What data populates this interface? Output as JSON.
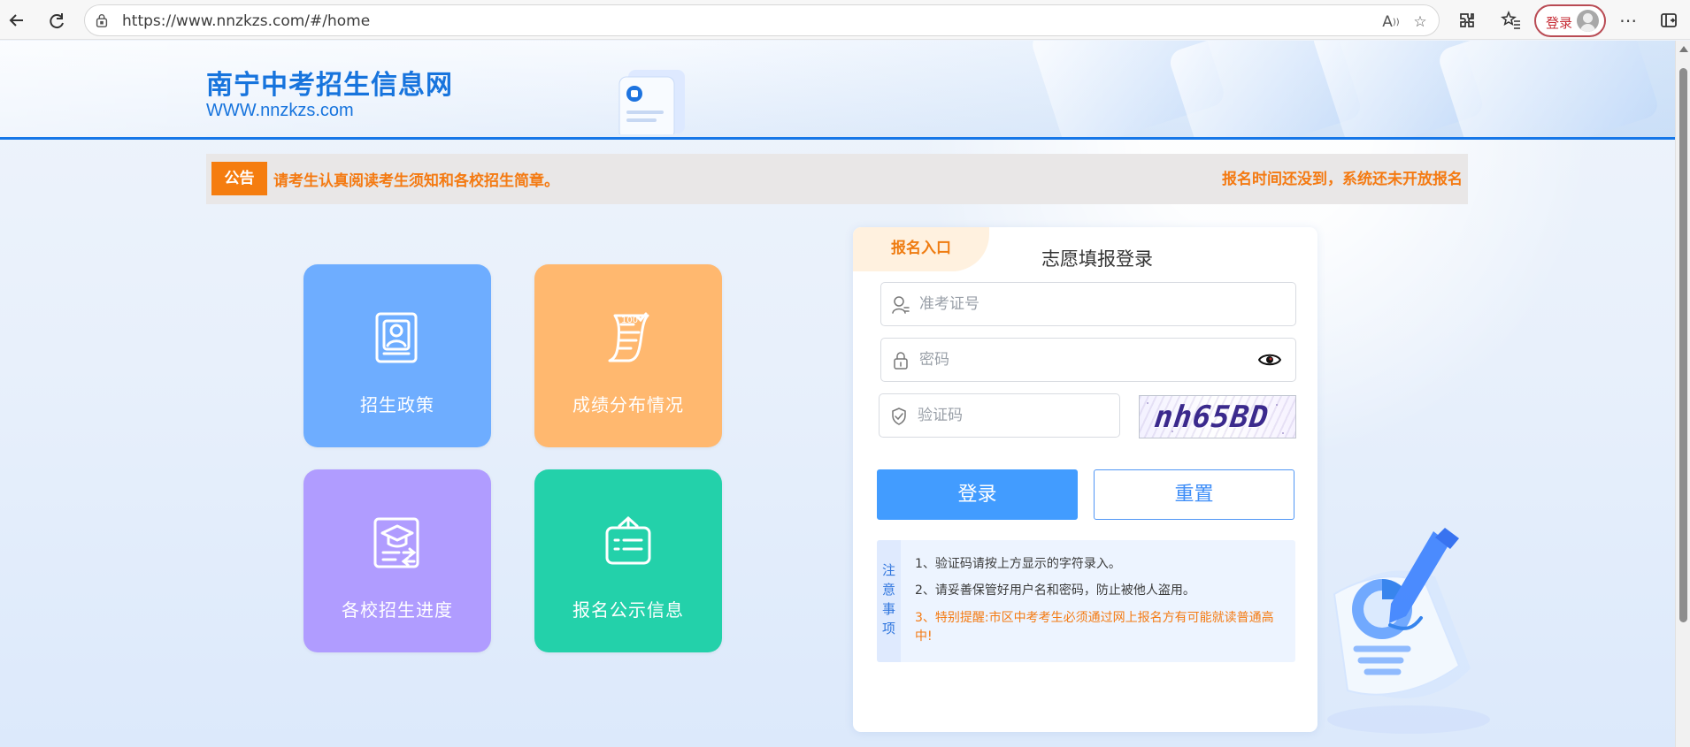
{
  "browser": {
    "url": "https://www.nnzkzs.com/#/home",
    "profile_login_label": "登录",
    "icons": {
      "back": "back-arrow-icon",
      "refresh": "refresh-icon",
      "lock": "lock-icon",
      "read_aloud": "read-aloud-icon",
      "favorite": "star-icon",
      "extensions": "extension-icon",
      "collections": "favorites-icon",
      "more": "more-icon",
      "split_screen": "split-screen-icon"
    }
  },
  "site": {
    "title": "南宁中考招生信息网",
    "domain": "WWW.nnzkzs.com"
  },
  "notice": {
    "badge": "公告",
    "message": "请考生认真阅读考生须知和各校招生简章。",
    "status": "报名时间还没到，系统还未开放报名"
  },
  "tiles": [
    {
      "label": "招生政策",
      "icon": "profile-document-icon",
      "color": "#6eadff"
    },
    {
      "label": "成绩分布情况",
      "icon": "score-scroll-icon",
      "color": "#ffb86f"
    },
    {
      "label": "各校招生进度",
      "icon": "graduation-progress-icon",
      "color": "#b09cff"
    },
    {
      "label": "报名公示信息",
      "icon": "public-notice-icon",
      "color": "#23d1aa"
    }
  ],
  "login": {
    "tab": "报名入口",
    "title": "志愿填报登录",
    "candidate_placeholder": "准考证号",
    "password_placeholder": "密码",
    "captcha_placeholder": "验证码",
    "captcha_text": "nh65BD",
    "login_button": "登录",
    "reset_button": "重置",
    "notes_label": "注\n意\n事\n项",
    "notes": [
      "1、验证码请按上方显示的字符录入。",
      "2、请妥善保管好用户名和密码，防止被他人盗用。",
      "3、特别提醒:市区中考考生必须通过网上报名方有可能就读普通高中!"
    ]
  },
  "colors": {
    "primary": "#1774dd",
    "notice_orange": "#f47a12",
    "login_blue": "#429cff"
  }
}
